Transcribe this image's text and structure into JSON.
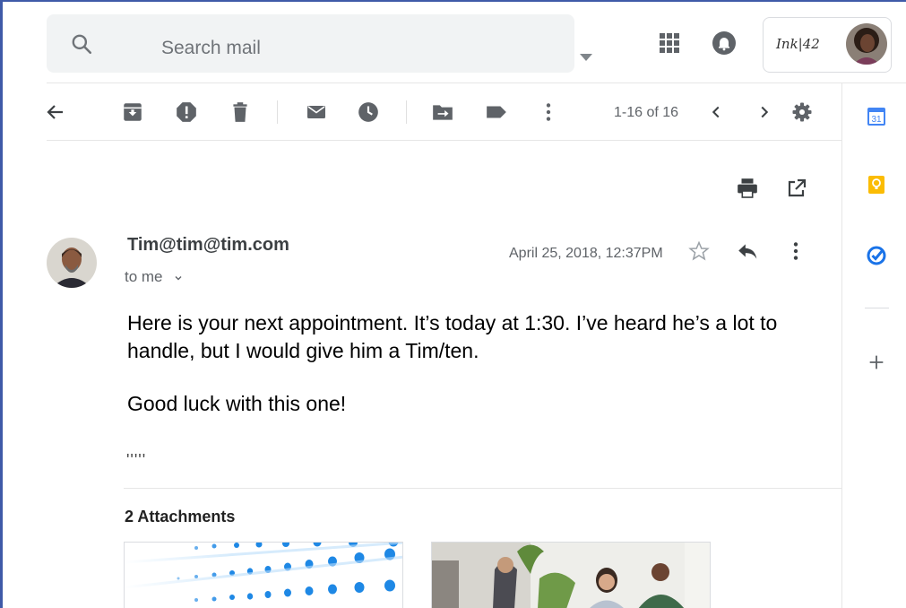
{
  "search": {
    "placeholder": "Search mail"
  },
  "account": {
    "logo_text": "Ink|42"
  },
  "toolbar": {
    "back": "back-arrow-icon",
    "pagination": "1-16 of 16"
  },
  "message": {
    "sender": "Tim@tim@tim.com",
    "recipient": "to me",
    "date": "April 25, 2018, 12:37PM",
    "body": "Here is your next appointment. It’s today at 1:30. I’ve heard he’s a lot to handle, but I would give him a Tim/ten.",
    "closing": "Good luck with this one!",
    "signature": "'''''"
  },
  "attachments": {
    "title": "2 Attachments",
    "items": [
      "dots-abstract-image",
      "office-meeting-photo"
    ]
  },
  "colors": {
    "accent_frame": "#3f5aa8",
    "icon_gray": "#5f6368",
    "calendar_blue": "#4285f4",
    "keep_yellow": "#fbbc04",
    "tasks_blue": "#1a73e8"
  }
}
